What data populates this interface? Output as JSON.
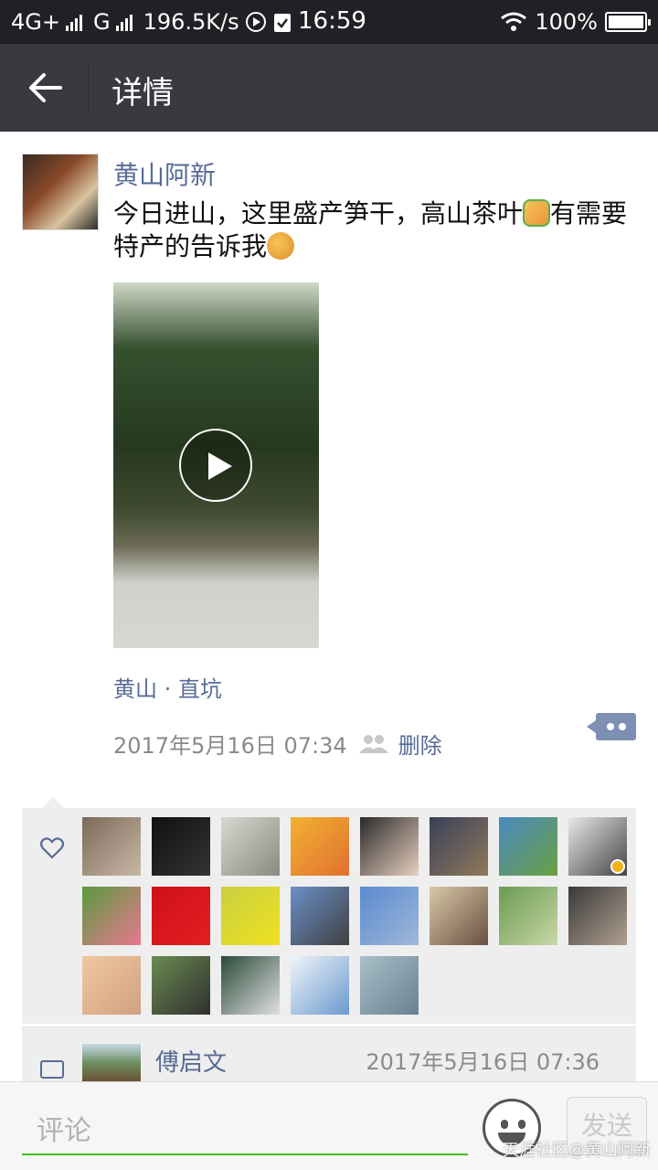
{
  "status_bar": {
    "network1": "4G+",
    "network2": "G",
    "speed": "196.5K/s",
    "time": "16:59",
    "battery": "100%"
  },
  "app_bar": {
    "title": "详情",
    "back_icon": "arrow-left-icon"
  },
  "post": {
    "author": "黄山阿新",
    "text_part1": "今日进山，这里盛产笋干，高山茶叶",
    "text_part2": "有需要特产的告诉我",
    "location": "黄山 · 直坑",
    "timestamp": "2017年5月16日 07:34",
    "delete_label": "删除",
    "icons": [
      "thumbs-up-emoji",
      "flex-arm-emoji",
      "play-icon",
      "people-icon",
      "more-icon"
    ]
  },
  "likes": {
    "icon": "heart-icon",
    "avatar_colors": [
      [
        "#7a6a5a",
        "#c9b8a8"
      ],
      [
        "#111111",
        "#333333"
      ],
      [
        "#d8d8d0",
        "#8a8a80"
      ],
      [
        "#f2b233",
        "#e07030"
      ],
      [
        "#2a2a2a",
        "#e8d0c0"
      ],
      [
        "#3a3f5a",
        "#8f7a5a"
      ],
      [
        "#4a8ac0",
        "#6aa040"
      ],
      [
        "#e8e8e8",
        "#444444"
      ],
      [
        "#5a9a40",
        "#e87890"
      ],
      [
        "#d0101a",
        "#e02020"
      ],
      [
        "#c8d040",
        "#f0e020"
      ],
      [
        "#6a90c8",
        "#404040"
      ],
      [
        "#5a8ad0",
        "#a0b8d8"
      ],
      [
        "#d8c8a8",
        "#6a5040"
      ],
      [
        "#6a9a50",
        "#c8d8a8"
      ],
      [
        "#3a3a3a",
        "#b0a090"
      ],
      [
        "#f0c8a0",
        "#d0a080"
      ],
      [
        "#6a8a50",
        "#303030"
      ],
      [
        "#2a4a3a",
        "#e0e0e0"
      ],
      [
        "#f0f4f8",
        "#6a9ad0"
      ],
      [
        "#a8c0c8",
        "#6a8090"
      ]
    ]
  },
  "comment": {
    "icon": "comment-icon",
    "name": "傅启文",
    "timestamp": "2017年5月16日 07:36"
  },
  "input_bar": {
    "placeholder": "评论",
    "send_label": "发送",
    "emoji_icon": "smiley-icon"
  },
  "watermark": "天涯社区@黄山阿新"
}
